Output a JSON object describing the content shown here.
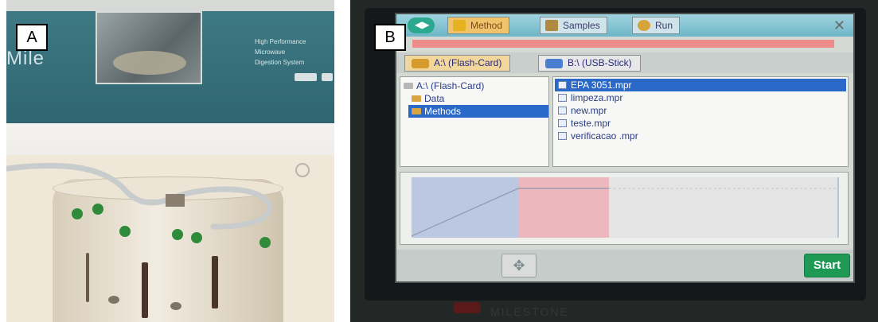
{
  "panel_a": {
    "label": "A",
    "banner": {
      "logo_fragment": "Mile",
      "text": "High Performance\nMicrowave\nDigestion System"
    }
  },
  "panel_b": {
    "label": "B",
    "toolbar": {
      "tabs": [
        {
          "label": "Method",
          "icon": "folder-icon",
          "active": true
        },
        {
          "label": "Samples",
          "icon": "balance-icon",
          "active": false
        },
        {
          "label": "Run",
          "icon": "gears-icon",
          "active": false
        }
      ]
    },
    "drives": [
      {
        "label": "A:\\ (Flash-Card)",
        "active": true
      },
      {
        "label": "B:\\ (USB-Stick)",
        "active": false
      }
    ],
    "tree": [
      {
        "label": "A:\\ (Flash-Card)",
        "selected": false
      },
      {
        "label": "Data",
        "selected": false
      },
      {
        "label": "Methods",
        "selected": true
      }
    ],
    "files": [
      {
        "label": "EPA 3051.mpr",
        "selected": true
      },
      {
        "label": "limpeza.mpr",
        "selected": false
      },
      {
        "label": "new.mpr",
        "selected": false
      },
      {
        "label": "teste.mpr",
        "selected": false
      },
      {
        "label": "verificacao .mpr",
        "selected": false
      }
    ],
    "start_label": "Start",
    "brand": "MILESTONE",
    "colors": {
      "start": "#1f9a55",
      "selection": "#2a69c8",
      "ramp_zone": "#bcc8e2",
      "hold_zone": "#ecb8be"
    }
  }
}
